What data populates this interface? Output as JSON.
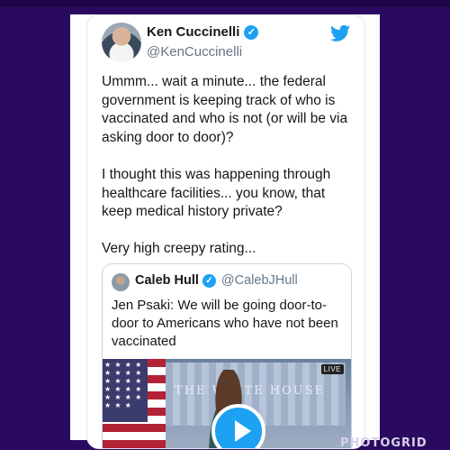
{
  "tweet": {
    "author_name": "Ken Cuccinelli",
    "author_handle": "@KenCuccinelli",
    "verified_mark": "✓",
    "paragraphs": [
      "Ummm... wait a minute... the federal government is keeping track of who is vaccinated and who is not (or will be via asking door to door)?",
      "I thought this was happening through healthcare facilities... you know, that keep medical history private?",
      "Very high creepy rating..."
    ],
    "icon": "twitter-bird-icon",
    "brand_color": "#1da1f2"
  },
  "quoted_tweet": {
    "author_name": "Caleb Hull",
    "author_handle": "@CalebJHull",
    "verified_mark": "✓",
    "text": "Jen Psaki: We will be going door-to-door to Americans who have not been vaccinated",
    "media": {
      "live_badge": "LIVE",
      "seal_text": "THE WHITE HOUSE",
      "play_icon": "play-icon"
    }
  },
  "watermark": "PHOTOGRID",
  "colors": {
    "background": "#2a0a5e",
    "card": "#ffffff",
    "text": "#14171a",
    "muted": "#657786"
  }
}
